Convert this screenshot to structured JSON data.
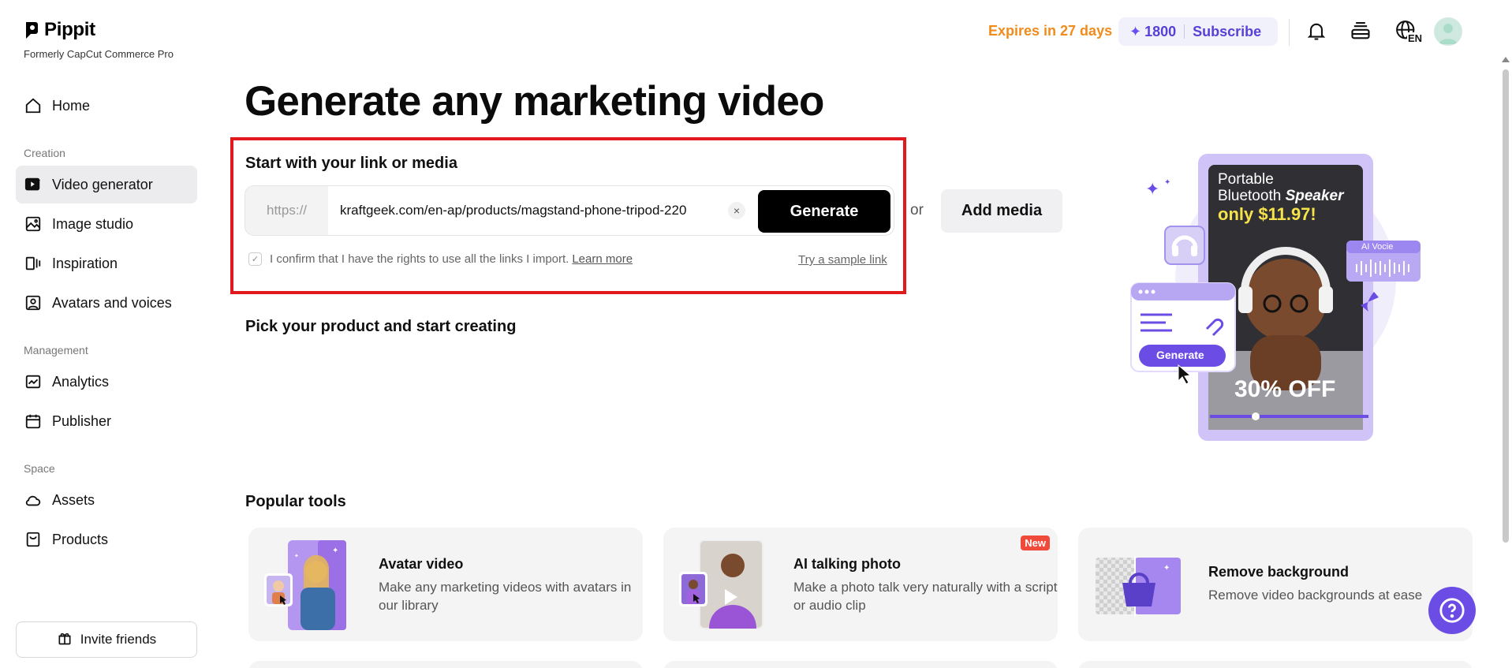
{
  "brand": {
    "name": "Pippit",
    "subtitle": "Formerly CapCut Commerce Pro"
  },
  "sidebar": {
    "home": "Home",
    "sections": {
      "creation": "Creation",
      "management": "Management",
      "space": "Space"
    },
    "items": {
      "video_generator": "Video generator",
      "image_studio": "Image studio",
      "inspiration": "Inspiration",
      "avatars_voices": "Avatars and voices",
      "analytics": "Analytics",
      "publisher": "Publisher",
      "assets": "Assets",
      "products": "Products"
    },
    "invite": "Invite friends"
  },
  "topbar": {
    "expires": "Expires in 27 days",
    "credits": "1800",
    "subscribe": "Subscribe",
    "language": "EN"
  },
  "main": {
    "title": "Generate any marketing video",
    "start_title": "Start with your link or media",
    "url_prefix": "https://",
    "url_value": "kraftgeek.com/en-ap/products/magstand-phone-tripod-220",
    "generate": "Generate",
    "or": "or",
    "add_media": "Add media",
    "confirm_text": "I confirm that I have the rights to use all the links I import.",
    "learn_more": "Learn more",
    "sample_link": "Try a sample link",
    "pick_title": "Pick your product and start creating"
  },
  "hero": {
    "line1": "Portable",
    "line2a": "Bluetooth ",
    "line2b": "Speaker",
    "price": "only $11.97!",
    "discount": "30% OFF",
    "voice_label": "AI Vocie",
    "generate_label": "Generate"
  },
  "popular": {
    "title": "Popular tools",
    "tools": [
      {
        "name": "Avatar video",
        "desc": "Make any marketing videos with avatars in our library"
      },
      {
        "name": "AI talking photo",
        "desc": "Make a photo talk very naturally with a script or audio clip",
        "badge": "New"
      },
      {
        "name": "Remove background",
        "desc": "Remove video backgrounds at ease"
      }
    ]
  },
  "colors": {
    "accent": "#6b4de6",
    "expire": "#f18b1c",
    "highlight_box": "#e1191d"
  }
}
